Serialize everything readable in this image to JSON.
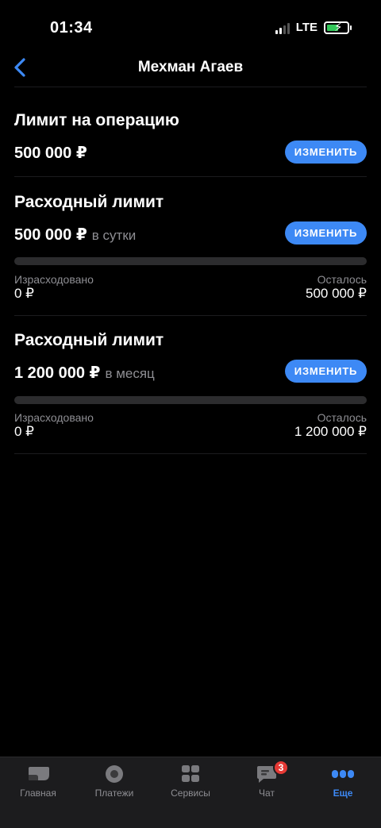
{
  "status": {
    "time": "01:34",
    "network": "LTE"
  },
  "header": {
    "title": "Мехман Агаев"
  },
  "limits": [
    {
      "title": "Лимит на операцию",
      "amount": "500 000 ₽",
      "period": "",
      "button": "ИЗМЕНИТЬ"
    },
    {
      "title": "Расходный лимит",
      "amount": "500 000 ₽",
      "period": "в сутки",
      "button": "ИЗМЕНИТЬ",
      "spent_label": "Израсходовано",
      "spent": "0 ₽",
      "left_label": "Осталось",
      "left": "500 000 ₽",
      "progress": 0
    },
    {
      "title": "Расходный лимит",
      "amount": "1 200 000 ₽",
      "period": "в месяц",
      "button": "ИЗМЕНИТЬ",
      "spent_label": "Израсходовано",
      "spent": "0 ₽",
      "left_label": "Осталось",
      "left": "1 200 000 ₽",
      "progress": 0
    }
  ],
  "tabs": [
    {
      "label": "Главная",
      "icon": "home-card-icon"
    },
    {
      "label": "Платежи",
      "icon": "payments-circle-icon"
    },
    {
      "label": "Сервисы",
      "icon": "services-grid-icon"
    },
    {
      "label": "Чат",
      "icon": "chat-icon",
      "badge": "3"
    },
    {
      "label": "Еще",
      "icon": "more-dots-icon",
      "active": true
    }
  ],
  "colors": {
    "accent": "#3d89f5",
    "background": "#000000",
    "badge": "#e53935",
    "muted": "#8e8e93"
  }
}
